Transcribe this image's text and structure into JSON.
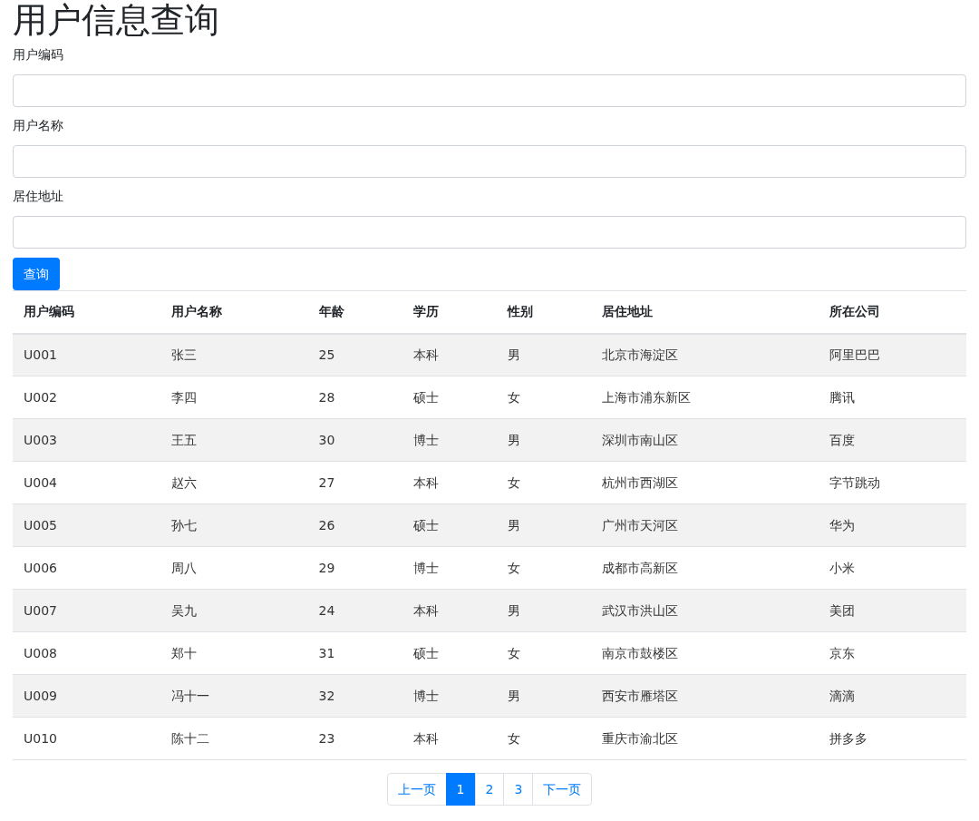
{
  "title": "用户信息查询",
  "form": {
    "fields": [
      {
        "label": "用户编码"
      },
      {
        "label": "用户名称"
      },
      {
        "label": "居住地址"
      }
    ],
    "submit": "查询"
  },
  "table": {
    "columns": [
      "用户编码",
      "用户名称",
      "年龄",
      "学历",
      "性别",
      "居住地址",
      "所在公司"
    ],
    "rows": [
      [
        "U001",
        "张三",
        "25",
        "本科",
        "男",
        "北京市海淀区",
        "阿里巴巴"
      ],
      [
        "U002",
        "李四",
        "28",
        "硕士",
        "女",
        "上海市浦东新区",
        "腾讯"
      ],
      [
        "U003",
        "王五",
        "30",
        "博士",
        "男",
        "深圳市南山区",
        "百度"
      ],
      [
        "U004",
        "赵六",
        "27",
        "本科",
        "女",
        "杭州市西湖区",
        "字节跳动"
      ],
      [
        "U005",
        "孙七",
        "26",
        "硕士",
        "男",
        "广州市天河区",
        "华为"
      ],
      [
        "U006",
        "周八",
        "29",
        "博士",
        "女",
        "成都市高新区",
        "小米"
      ],
      [
        "U007",
        "吴九",
        "24",
        "本科",
        "男",
        "武汉市洪山区",
        "美团"
      ],
      [
        "U008",
        "郑十",
        "31",
        "硕士",
        "女",
        "南京市鼓楼区",
        "京东"
      ],
      [
        "U009",
        "冯十一",
        "32",
        "博士",
        "男",
        "西安市雁塔区",
        "滴滴"
      ],
      [
        "U010",
        "陈十二",
        "23",
        "本科",
        "女",
        "重庆市渝北区",
        "拼多多"
      ]
    ]
  },
  "pagination": [
    {
      "label": "上一页",
      "selected": false
    },
    {
      "label": "1",
      "selected": true
    },
    {
      "label": "2",
      "selected": false
    },
    {
      "label": "3",
      "selected": false
    },
    {
      "label": "下一页",
      "selected": false
    }
  ]
}
